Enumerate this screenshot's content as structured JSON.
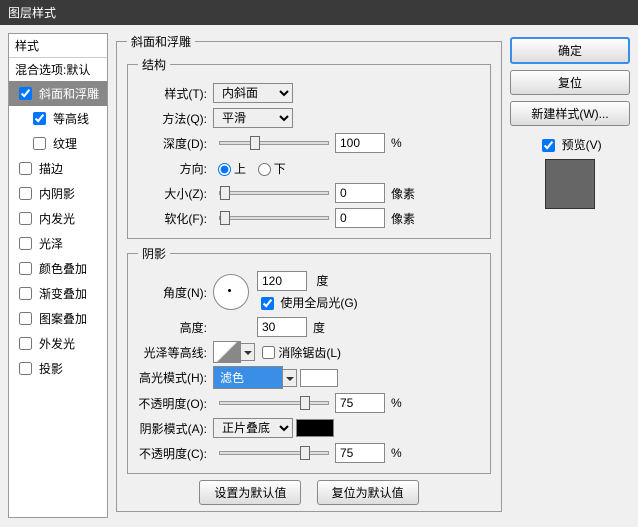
{
  "window": {
    "title": "图层样式"
  },
  "sidebar": {
    "header": "样式",
    "blend_options": "混合选项:默认",
    "items": [
      {
        "label": "斜面和浮雕",
        "checked": true,
        "active": true,
        "indent": false
      },
      {
        "label": "等高线",
        "checked": true,
        "active": false,
        "indent": true
      },
      {
        "label": "纹理",
        "checked": false,
        "active": false,
        "indent": true
      },
      {
        "label": "描边",
        "checked": false,
        "active": false,
        "indent": false
      },
      {
        "label": "内阴影",
        "checked": false,
        "active": false,
        "indent": false
      },
      {
        "label": "内发光",
        "checked": false,
        "active": false,
        "indent": false
      },
      {
        "label": "光泽",
        "checked": false,
        "active": false,
        "indent": false
      },
      {
        "label": "颜色叠加",
        "checked": false,
        "active": false,
        "indent": false
      },
      {
        "label": "渐变叠加",
        "checked": false,
        "active": false,
        "indent": false
      },
      {
        "label": "图案叠加",
        "checked": false,
        "active": false,
        "indent": false
      },
      {
        "label": "外发光",
        "checked": false,
        "active": false,
        "indent": false
      },
      {
        "label": "投影",
        "checked": false,
        "active": false,
        "indent": false
      }
    ]
  },
  "panel_title": "斜面和浮雕",
  "structure": {
    "legend": "结构",
    "style_label": "样式(T):",
    "style_value": "内斜面",
    "technique_label": "方法(Q):",
    "technique_value": "平滑",
    "depth_label": "深度(D):",
    "depth_value": "100",
    "depth_unit": "%",
    "direction_label": "方向:",
    "up": "上",
    "down": "下",
    "size_label": "大小(Z):",
    "size_value": "0",
    "size_unit": "像素",
    "soften_label": "软化(F):",
    "soften_value": "0",
    "soften_unit": "像素"
  },
  "shading": {
    "legend": "阴影",
    "angle_label": "角度(N):",
    "angle_value": "120",
    "angle_unit": "度",
    "global_light": "使用全局光(G)",
    "altitude_label": "高度:",
    "altitude_value": "30",
    "altitude_unit": "度",
    "gloss_contour_label": "光泽等高线:",
    "antialias": "消除锯齿(L)",
    "highlight_mode_label": "高光模式(H):",
    "highlight_mode_value": "滤色",
    "highlight_opacity_label": "不透明度(O):",
    "highlight_opacity_value": "75",
    "opacity_unit": "%",
    "shadow_mode_label": "阴影模式(A):",
    "shadow_mode_value": "正片叠底",
    "shadow_opacity_label": "不透明度(C):",
    "shadow_opacity_value": "75"
  },
  "footer": {
    "make_default": "设置为默认值",
    "reset_default": "复位为默认值"
  },
  "buttons": {
    "ok": "确定",
    "cancel": "复位",
    "new_style": "新建样式(W)...",
    "preview": "预览(V)"
  }
}
